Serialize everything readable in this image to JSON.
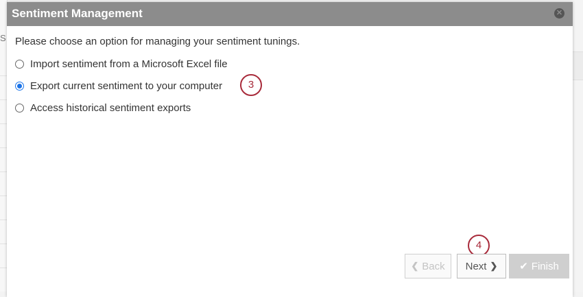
{
  "background": {
    "left_char": "S"
  },
  "dialog": {
    "title": "Sentiment Management",
    "close_icon": "close-circle-icon",
    "prompt": "Please choose an option for managing your sentiment tunings.",
    "options": [
      {
        "label": "Import sentiment from a Microsoft Excel file",
        "selected": false
      },
      {
        "label": "Export current sentiment to your computer",
        "selected": true
      },
      {
        "label": "Access historical sentiment exports",
        "selected": false
      }
    ],
    "step_badges": [
      "3",
      "4"
    ],
    "buttons": {
      "back": "Back",
      "next": "Next",
      "finish": "Finish"
    }
  },
  "colors": {
    "header_bg": "#8c8c8c",
    "radio_selected": "#1a73e8",
    "badge": "#a82a3a"
  }
}
